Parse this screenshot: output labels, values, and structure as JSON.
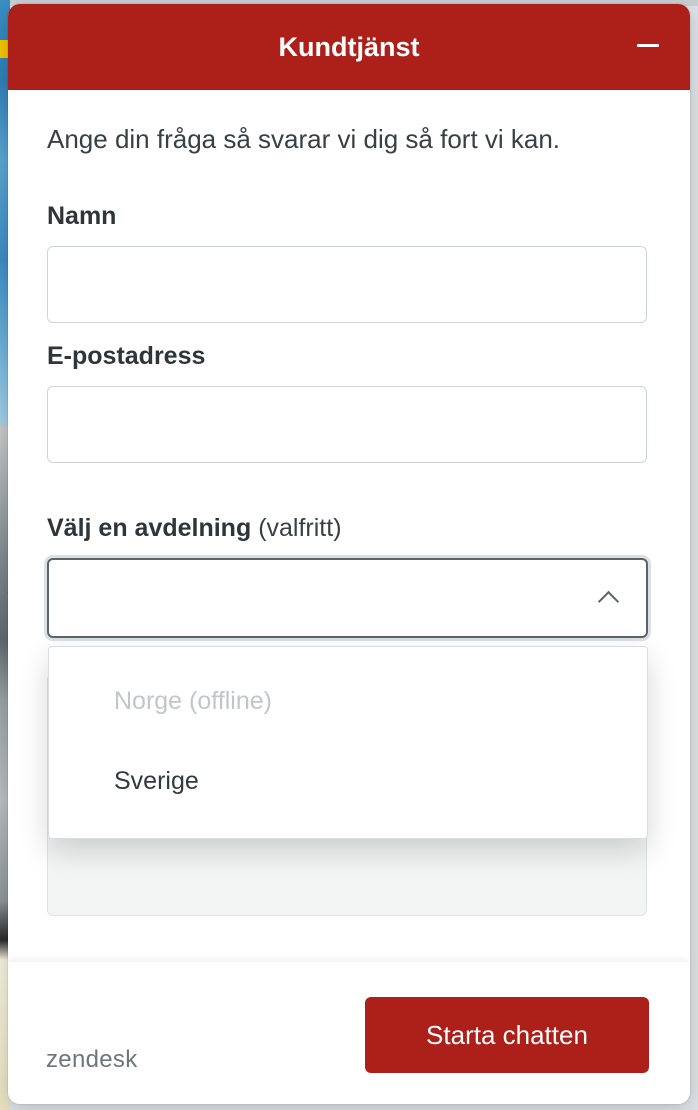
{
  "widget": {
    "title": "Kundtjänst",
    "accent_color": "#ad1f19",
    "minimize_icon": "minus-icon"
  },
  "form": {
    "intro": "Ange din fråga så svarar vi dig så fort vi kan.",
    "name_label": "Namn",
    "name_value": "",
    "email_label": "E-postadress",
    "email_value": "",
    "department_label": "Välj en avdelning",
    "department_optional": "(valfritt)",
    "department_value": "",
    "department_icon": "chevron-up-icon",
    "department_options": [
      {
        "label": "Norge (offline)",
        "disabled": true
      },
      {
        "label": "Sverige",
        "disabled": false
      }
    ]
  },
  "footer": {
    "brand": "zendesk",
    "start_button": "Starta chatten"
  }
}
